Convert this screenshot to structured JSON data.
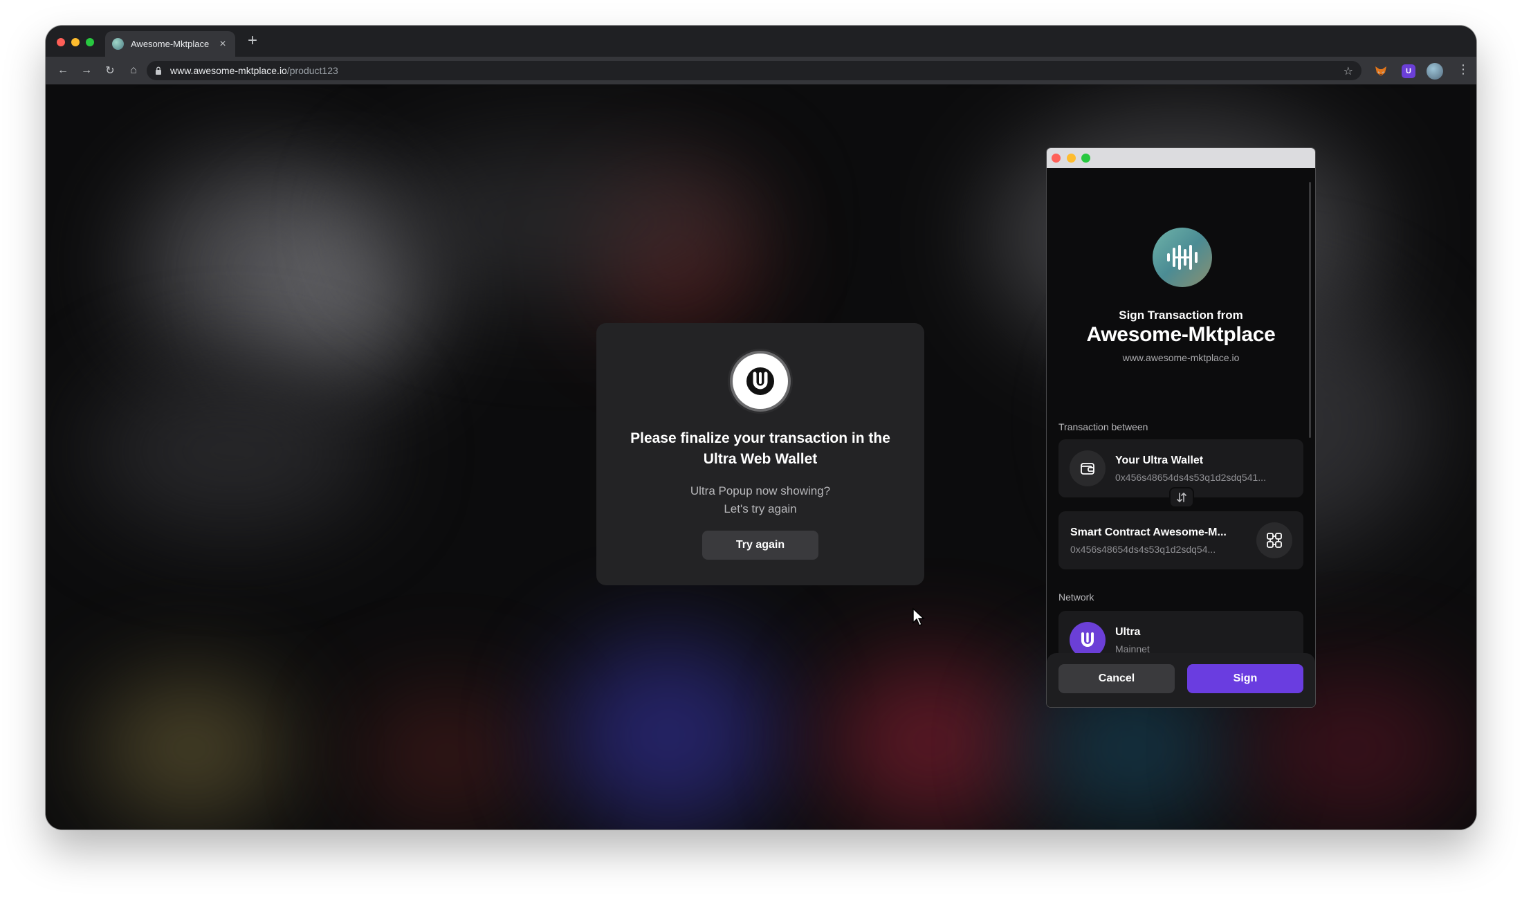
{
  "browser": {
    "tab_title": "Awesome-Mktplace",
    "tab_close": "×",
    "new_tab": "+",
    "url_host": "www.awesome-mktplace.io",
    "url_path": "/product123",
    "nav": {
      "back": "←",
      "forward": "→",
      "reload": "↻",
      "home": "⌂"
    },
    "star": "☆",
    "menu": "⋮",
    "extensions": [
      {
        "name": "metamask-fox-icon"
      },
      {
        "name": "ultra-extension-icon",
        "label": "U"
      },
      {
        "name": "profile-avatar"
      }
    ]
  },
  "modal": {
    "title": "Please finalize your transaction in the Ultra Web Wallet",
    "subtitle_line1": "Ultra Popup now showing?",
    "subtitle_line2": "Let's try again",
    "button": "Try again"
  },
  "popup": {
    "sign_from": "Sign Transaction from",
    "dapp_name": "Awesome-Mktplace",
    "dapp_url": "www.awesome-mktplace.io",
    "transaction_label": "Transaction between",
    "from": {
      "title": "Your Ultra Wallet",
      "address": "0x456s48654ds4s53q1d2sdq541..."
    },
    "to": {
      "title": "Smart Contract Awesome-M...",
      "address": "0x456s48654ds4s53q1d2sdq54..."
    },
    "network_label": "Network",
    "network": {
      "name": "Ultra",
      "type": "Mainnet"
    },
    "cancel": "Cancel",
    "sign": "Sign"
  },
  "colors": {
    "accent_purple": "#6a3de0",
    "modal_bg": "#232325",
    "page_bg": "#0c0c0d"
  }
}
